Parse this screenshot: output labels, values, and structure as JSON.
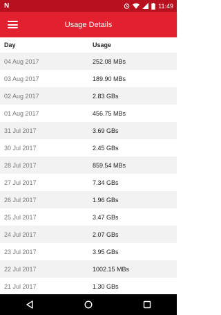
{
  "status_bar": {
    "time": "11:49",
    "icons": [
      "notification-n-icon",
      "alarm-icon",
      "wifi-icon",
      "signal-icon",
      "battery-icon"
    ]
  },
  "app_bar": {
    "title": "Usage Details",
    "menu_icon": "hamburger-menu-icon",
    "color": "#e2202f"
  },
  "table": {
    "headers": {
      "day": "Day",
      "usage": "Usage"
    },
    "rows": [
      {
        "day": "04 Aug 2017",
        "usage": "252.08 MBs"
      },
      {
        "day": "03 Aug 2017",
        "usage": "189.90 MBs"
      },
      {
        "day": "02 Aug 2017",
        "usage": "2.83 GBs"
      },
      {
        "day": "01 Aug 2017",
        "usage": "456.75 MBs"
      },
      {
        "day": "31 Jul 2017",
        "usage": "3.69 GBs"
      },
      {
        "day": "30 Jul 2017",
        "usage": "2.45 GBs"
      },
      {
        "day": "28 Jul 2017",
        "usage": "859.54 MBs"
      },
      {
        "day": "27 Jul 2017",
        "usage": "7.34 GBs"
      },
      {
        "day": "26 Jul 2017",
        "usage": "1.96 GBs"
      },
      {
        "day": "25 Jul 2017",
        "usage": "3.47 GBs"
      },
      {
        "day": "24 Jul 2017",
        "usage": "2.07 GBs"
      },
      {
        "day": "23 Jul 2017",
        "usage": "3.95 GBs"
      },
      {
        "day": "22 Jul 2017",
        "usage": "1002.15 MBs"
      },
      {
        "day": "21 Jul 2017",
        "usage": "1.30 GBs"
      }
    ]
  },
  "nav_bar": {
    "icons": [
      "back-icon",
      "home-icon",
      "recents-icon"
    ]
  }
}
